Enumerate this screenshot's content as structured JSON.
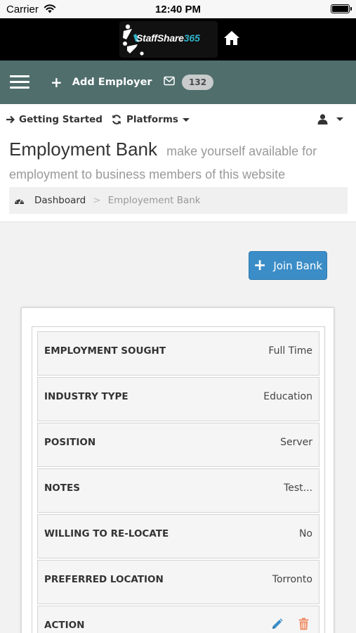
{
  "status_bar": {
    "carrier": "Carrier",
    "time": "12:40 PM"
  },
  "brand": {
    "logo_main": "StaffShare",
    "logo_accent": "365",
    "home_icon": "home-icon"
  },
  "navbar": {
    "add_employer": "Add Employer",
    "message_count": "132"
  },
  "top_nav": {
    "getting_started": "Getting Started",
    "platforms": "Platforms"
  },
  "header": {
    "title": "Employment Bank",
    "subtitle": "make yourself available for employment to business members of this website"
  },
  "breadcrumb": {
    "home": "Dashboard",
    "separator": ">",
    "current": "Employement Bank"
  },
  "join_button": {
    "label": "Join Bank"
  },
  "details": {
    "rows": [
      {
        "label": "EMPLOYMENT SOUGHT",
        "value": "Full Time"
      },
      {
        "label": "INDUSTRY TYPE",
        "value": "Education"
      },
      {
        "label": "POSITION",
        "value": "Server"
      },
      {
        "label": "NOTES",
        "value": "Test..."
      },
      {
        "label": "WILLING TO RE-LOCATE",
        "value": "No"
      },
      {
        "label": "PREFERRED LOCATION",
        "value": "Torronto"
      },
      {
        "label": "ACTION",
        "value": ""
      }
    ]
  },
  "colors": {
    "navbar": "#4f6e6c",
    "brand_bar": "#000000",
    "join_button": "#3b8dc7",
    "edit_icon": "#3b8dc7",
    "delete_icon": "#f0906a"
  }
}
